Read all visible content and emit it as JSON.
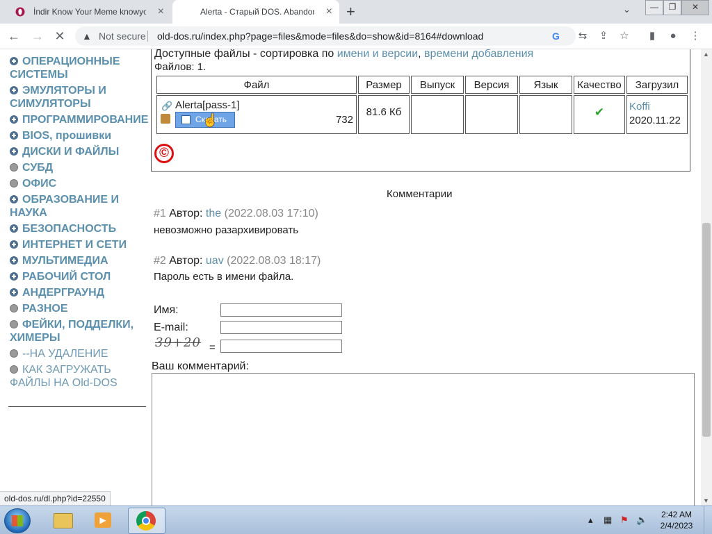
{
  "browser": {
    "tabs": [
      {
        "title": "İndir Know Your Meme knowyourmeme",
        "close": "×"
      },
      {
        "title": "Alerta - Старый DOS. Abandonware",
        "close": "×"
      }
    ],
    "new_tab": "+",
    "tab_list": "⌄",
    "window_controls": {
      "minimize": "—",
      "maximize": "❐",
      "close": "✕"
    },
    "nav": {
      "back": "←",
      "forward": "→",
      "stop": "✕"
    },
    "security_warning": "▲",
    "security_label": "Not secure",
    "url": "old-dos.ru/index.php?page=files&mode=files&do=show&id=8164#download",
    "status_url": "old-dos.ru/dl.php?id=22550"
  },
  "sidebar": {
    "categories": [
      {
        "label": "ОПЕРАЦИОННЫЕ СИСТЕМЫ",
        "bullet": "plus"
      },
      {
        "label": "ЭМУЛЯТОРЫ И СИМУЛЯТОРЫ",
        "bullet": "plus"
      },
      {
        "label": "ПРОГРАММИРОВАНИЕ",
        "bullet": "plus"
      },
      {
        "label": "BIOS, прошивки",
        "bullet": "plus"
      },
      {
        "label": "ДИСКИ И ФАЙЛЫ",
        "bullet": "plus"
      },
      {
        "label": "СУБД",
        "bullet": "circle"
      },
      {
        "label": "ОФИС",
        "bullet": "circle"
      },
      {
        "label": "ОБРАЗОВАНИЕ И НАУКА",
        "bullet": "plus"
      },
      {
        "label": "БЕЗОПАСНОСТЬ",
        "bullet": "plus"
      },
      {
        "label": "ИНТЕРНЕТ И СЕТИ",
        "bullet": "plus"
      },
      {
        "label": "МУЛЬТИМЕДИА",
        "bullet": "plus"
      },
      {
        "label": "РАБОЧИЙ СТОЛ",
        "bullet": "plus"
      },
      {
        "label": "АНДЕРГРАУНД",
        "bullet": "plus"
      },
      {
        "label": "РАЗНОЕ",
        "bullet": "circle"
      },
      {
        "label": "ФЕЙКИ, ПОДДЕЛКИ, ХИМЕРЫ",
        "bullet": "circle"
      },
      {
        "label": "--НА УДАЛЕНИЕ",
        "bullet": "circle"
      },
      {
        "label": "КАК ЗАГРУЖАТЬ ФАЙЛЫ НА Old-DOS",
        "bullet": "circle"
      }
    ]
  },
  "files": {
    "sort_prefix": "Доступные файлы - сортировка по ",
    "sort_by_name": "имени и версии",
    "sort_comma": ", ",
    "sort_by_date": "времени добавления",
    "count_label": "Файлов: 1.",
    "columns": [
      "Файл",
      "Размер",
      "Выпуск",
      "Версия",
      "Язык",
      "Качество",
      "Загрузил"
    ],
    "row": {
      "name": "Alerta[pass-1]",
      "download_label": "Скачать",
      "downloads": "732",
      "size": "81.6 Кб",
      "release": "",
      "version": "",
      "language": "",
      "quality": "✔",
      "uploader": "Koffi",
      "upload_date": "2020.11.22"
    },
    "copyright_symbol": "©"
  },
  "comments": {
    "heading": "Комментарии",
    "items": [
      {
        "num": "#1",
        "author_label": "Автор: ",
        "author": "the",
        "date": "(2022.08.03 17:10)",
        "text": "невозможно разархивировать"
      },
      {
        "num": "#2",
        "author_label": "Автор: ",
        "author": "uav",
        "date": "(2022.08.03 18:17)",
        "text": "Пароль есть в имени файла."
      }
    ],
    "form": {
      "name_label": "Имя:",
      "email_label": "E-mail:",
      "captcha_text": "39+20",
      "captcha_eq": "=",
      "comment_label": "Ваш комментарий:"
    }
  },
  "taskbar": {
    "clock_time": "2:42 AM",
    "clock_date": "2/4/2023"
  }
}
